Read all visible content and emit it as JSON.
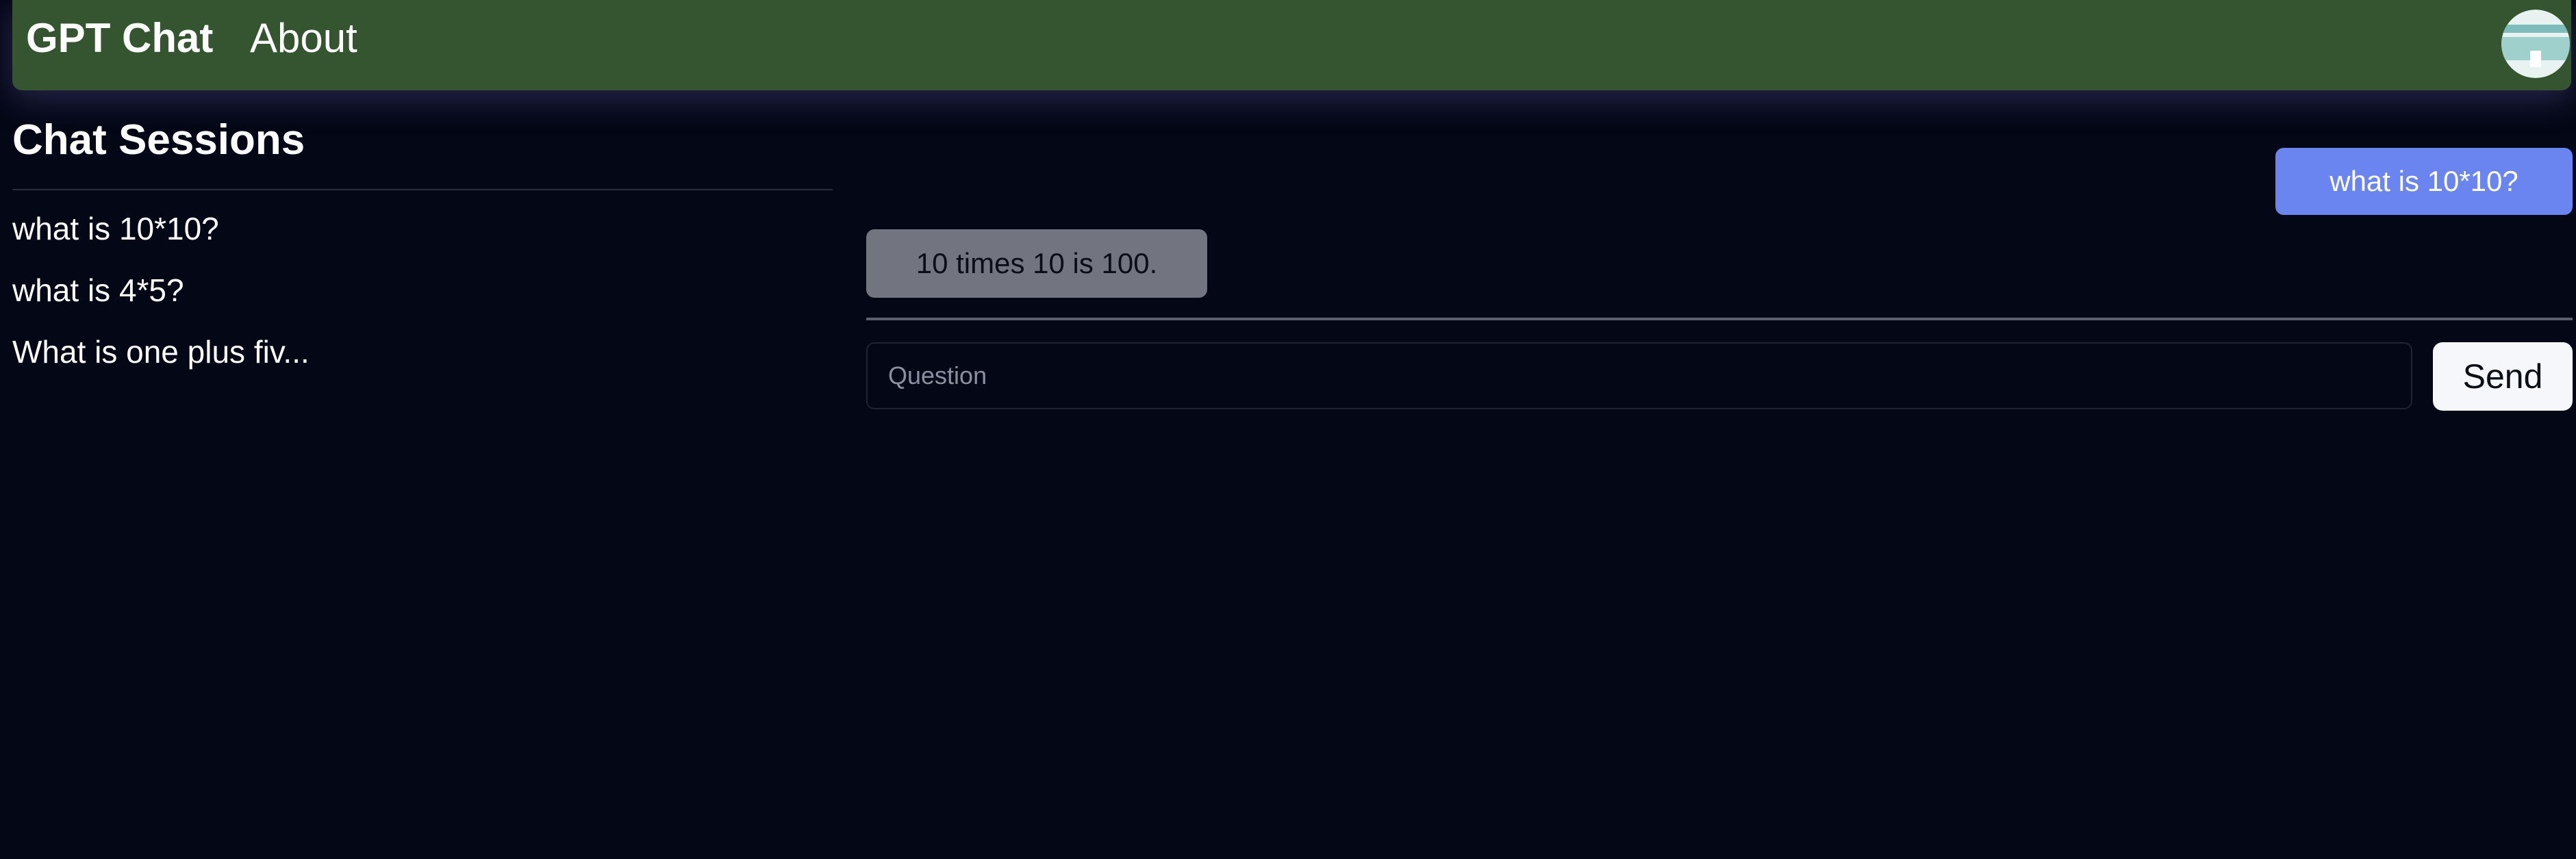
{
  "navbar": {
    "brand": "GPT Chat",
    "about": "About",
    "avatar_icon": "avatar-icon",
    "color": "#355530"
  },
  "sidebar": {
    "title": "Chat Sessions",
    "sessions": [
      {
        "label": "what is 10*10?"
      },
      {
        "label": "what is 4*5?"
      },
      {
        "label": "What is one plus fiv..."
      }
    ]
  },
  "chat": {
    "messages": [
      {
        "role": "user",
        "text": "what is 10*10?",
        "color": "#6b85f0"
      },
      {
        "role": "assistant",
        "text": "10 times 10 is 100.",
        "color": "#72747f"
      }
    ],
    "input": {
      "placeholder": "Question",
      "value": ""
    },
    "send_label": "Send"
  }
}
